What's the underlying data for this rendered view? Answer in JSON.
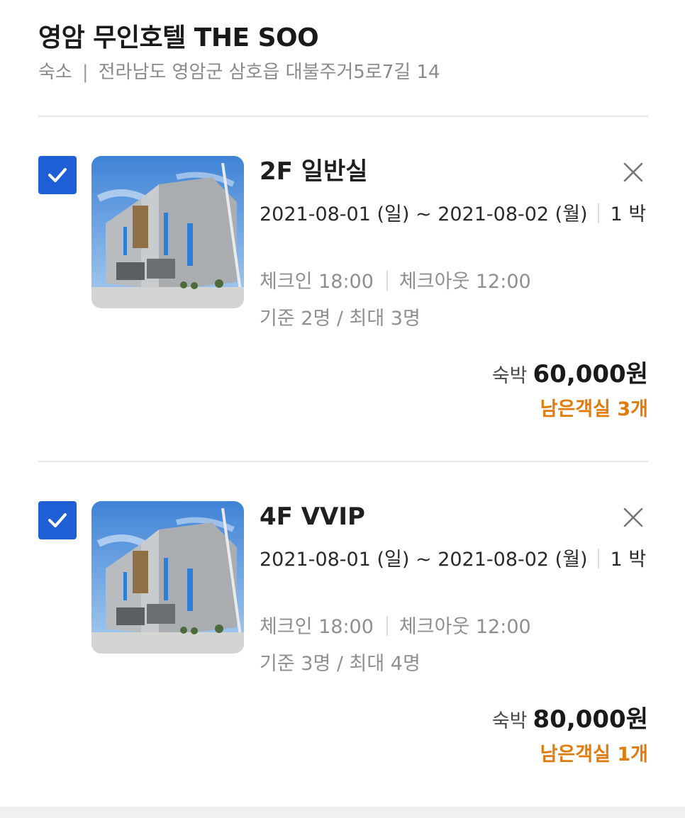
{
  "header": {
    "title": "영암 무인호텔 THE SOO",
    "category": "숙소",
    "separator": "|",
    "address": "전라남도 영암군 삼호읍 대불주거5로7길 14"
  },
  "rooms": [
    {
      "checked": true,
      "name": "2F 일반실",
      "dates": "2021-08-01 (일) ~ 2021-08-02 (월)",
      "nights": "1 박",
      "checkin": "체크인 18:00",
      "checkout": "체크아웃 12:00",
      "capacity": "기준 2명 / 최대 3명",
      "price_label": "숙박",
      "price": "60,000원",
      "remaining_label": "남은객실",
      "remaining": "3개"
    },
    {
      "checked": true,
      "name": "4F VVIP",
      "dates": "2021-08-01 (일) ~ 2021-08-02 (월)",
      "nights": "1 박",
      "checkin": "체크인 18:00",
      "checkout": "체크아웃 12:00",
      "capacity": "기준 3명 / 최대 4명",
      "price_label": "숙박",
      "price": "80,000원",
      "remaining_label": "남은객실",
      "remaining": "1개"
    }
  ],
  "icons": {
    "checkbox": "check-icon",
    "remove": "close-icon"
  },
  "colors": {
    "checkbox_blue": "#1e5fd6",
    "remaining_orange": "#e07b0e",
    "muted_text": "#8f8f8f",
    "divider": "#e6e6e6"
  }
}
